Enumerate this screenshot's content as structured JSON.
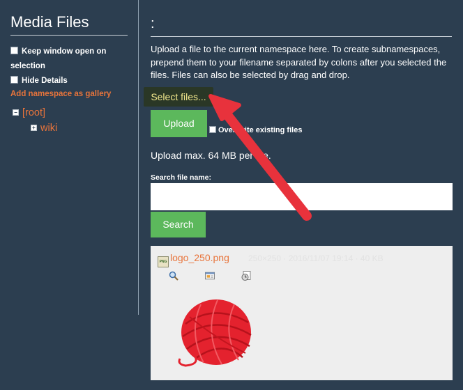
{
  "sidebar": {
    "title": "Media Files",
    "keep_open_label": "Keep window open on",
    "keep_open_label_2": "selection",
    "hide_details_label": "Hide Details",
    "add_namespace_label": "Add namespace as gallery",
    "tree": {
      "root_label": "[root]",
      "child_label": "wiki"
    }
  },
  "main": {
    "title": ":",
    "intro_line1": "Upload a file to the current namespace here. To create subnamespaces,",
    "intro_line2": "prepend them to your filename separated by colons after you selected the",
    "intro_line3": "files. Files can also be selected by drag and drop.",
    "select_files_label": "Select files...",
    "upload_label": "Upload",
    "overwrite_label": "Overwrite existing files",
    "max_size_text": "Upload max. 64 MB per file.",
    "search_label": "Search file name:",
    "search_value": "",
    "search_button": "Search"
  },
  "file": {
    "name": "logo_250.png",
    "meta": "250×250 · 2016/11/07 19:14 · 40 KB",
    "icon_label": "PNG"
  },
  "colors": {
    "background": "#2c3e50",
    "accent_link": "#e8743b",
    "button_green": "#5cb85c",
    "arrow_red": "#e8323c"
  }
}
